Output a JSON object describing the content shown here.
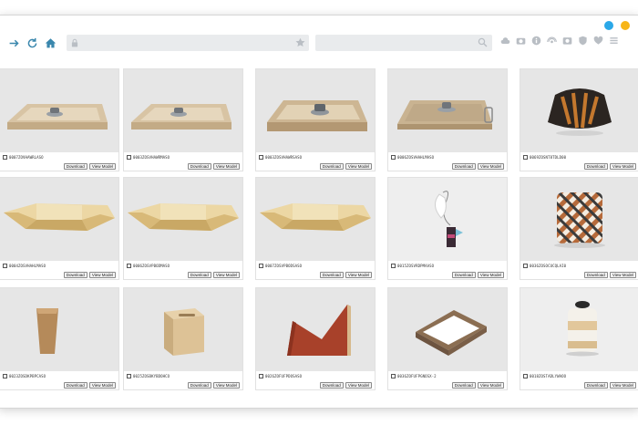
{
  "colors": {
    "dot_blue": "#2ba8e8",
    "dot_yellow": "#f7b518",
    "nav_icon": "#3a87ad",
    "ext_icon": "#b9bec4"
  },
  "toolbar": {
    "forward_icon": "arrow-right-icon",
    "reload_icon": "reload-icon",
    "home_icon": "home-icon",
    "ext_icons": [
      "cloud-icon",
      "camera-icon",
      "info-icon",
      "broadcast-icon",
      "photo-icon",
      "shield-icon",
      "heart-icon",
      "menu-icon"
    ]
  },
  "products": [
    {
      "code": "0007ZOVHAWRLASO",
      "shape": "tray"
    },
    {
      "code": "0003ZOSVHAWRMASO",
      "shape": "tray"
    },
    {
      "code": "0003ZOSVHAWRSASO",
      "shape": "tray-dark"
    },
    {
      "code": "0006ZOSVHAHLMASO",
      "shape": "tray-handle"
    },
    {
      "code": "0069ZOSNT8TDLD00",
      "shape": "lamp"
    },
    {
      "code": "0004ZOSVHAHLMASO",
      "shape": "catchall"
    },
    {
      "code": "0006ZOSVPBODMASO",
      "shape": "catchall"
    },
    {
      "code": "0007ZOSVPBODSASO",
      "shape": "catchall"
    },
    {
      "code": "0015ZOSVRDPMAASO",
      "shape": "tag"
    },
    {
      "code": "0036ZOSOCUCQLAI0",
      "shape": "pillow"
    },
    {
      "code": "0023ZOSDKPBPCASO",
      "shape": "bin"
    },
    {
      "code": "0025ZOSBKYBDOHCO",
      "shape": "tissue"
    },
    {
      "code": "0026ZOFUFPDOSASO",
      "shape": "bookend"
    },
    {
      "code": "0036ZOFUFPGNOSX-2",
      "shape": "notebox"
    },
    {
      "code": "0018ZOSTADLYWAOO",
      "shape": "vase"
    }
  ],
  "buttons": {
    "download": "Download",
    "view_model": "View Model"
  }
}
